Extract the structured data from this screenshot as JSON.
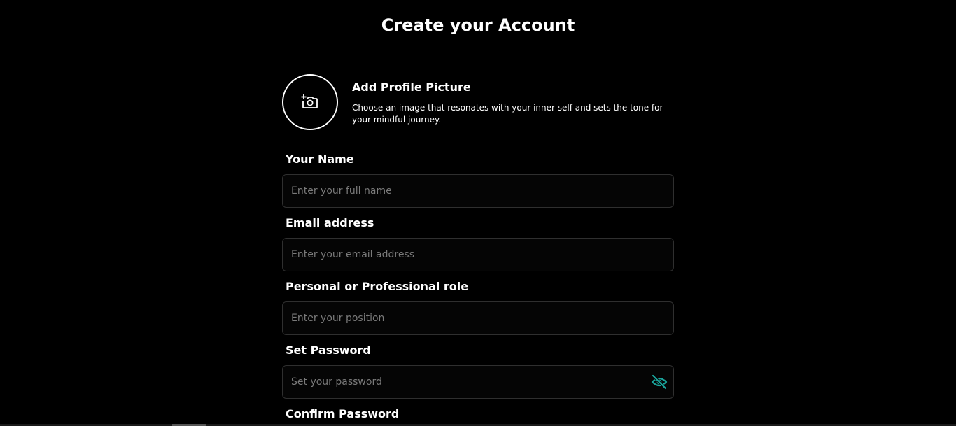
{
  "header": {
    "title": "Create your Account"
  },
  "profile_picture": {
    "title": "Add Profile Picture",
    "description": "Choose an image that resonates with your inner self and sets the tone for your mindful journey.",
    "icon": "add-photo-icon"
  },
  "fields": {
    "name": {
      "label": "Your Name",
      "placeholder": "Enter your full name",
      "value": ""
    },
    "email": {
      "label": "Email address",
      "placeholder": "Enter your email address",
      "value": ""
    },
    "role": {
      "label": "Personal or Professional role",
      "placeholder": "Enter your position",
      "value": ""
    },
    "password": {
      "label": "Set Password",
      "placeholder": "Set your password",
      "value": "",
      "toggle_icon": "eye-off-icon"
    },
    "confirm_password": {
      "label": "Confirm Password"
    }
  },
  "colors": {
    "background": "#000000",
    "text": "#ffffff",
    "accent": "#1aa39a",
    "input_border": "#2f2f2f",
    "placeholder": "#7a7a7a"
  }
}
